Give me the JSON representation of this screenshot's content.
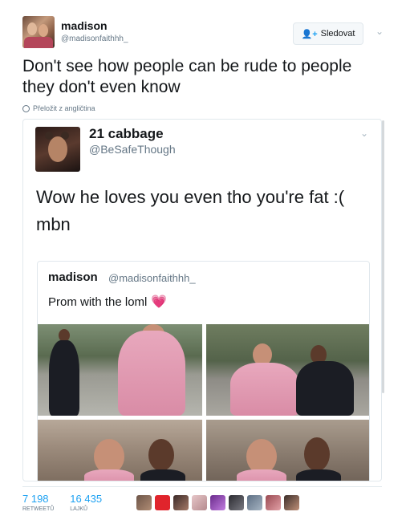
{
  "tweet": {
    "author": {
      "display_name": "madison",
      "handle": "@madisonfaithhh_"
    },
    "follow_label": "Sledovat",
    "text": "Don't see how people can be rude to people they don't even know",
    "translate_label": "Přeložit z angličtina"
  },
  "quoted": {
    "author": {
      "display_name": "21 cabbage",
      "handle": "@BeSafeThough"
    },
    "text": "Wow he loves you even tho you're fat :( mbn",
    "inner": {
      "author": {
        "display_name": "madison",
        "handle": "@madisonfaithhh_"
      },
      "text": "Prom with the loml",
      "emoji": "💗"
    }
  },
  "stats": {
    "retweets": {
      "count": "7 198",
      "label": "RETWEETŮ"
    },
    "likes": {
      "count": "16 435",
      "label": "LAJKŮ"
    }
  },
  "likers": [
    "avatar",
    "avatar",
    "avatar",
    "avatar",
    "avatar",
    "avatar",
    "avatar",
    "avatar",
    "avatar",
    "avatar"
  ],
  "colors": {
    "accent": "#1da1f2",
    "muted": "#657786",
    "border": "#e1e8ed"
  }
}
